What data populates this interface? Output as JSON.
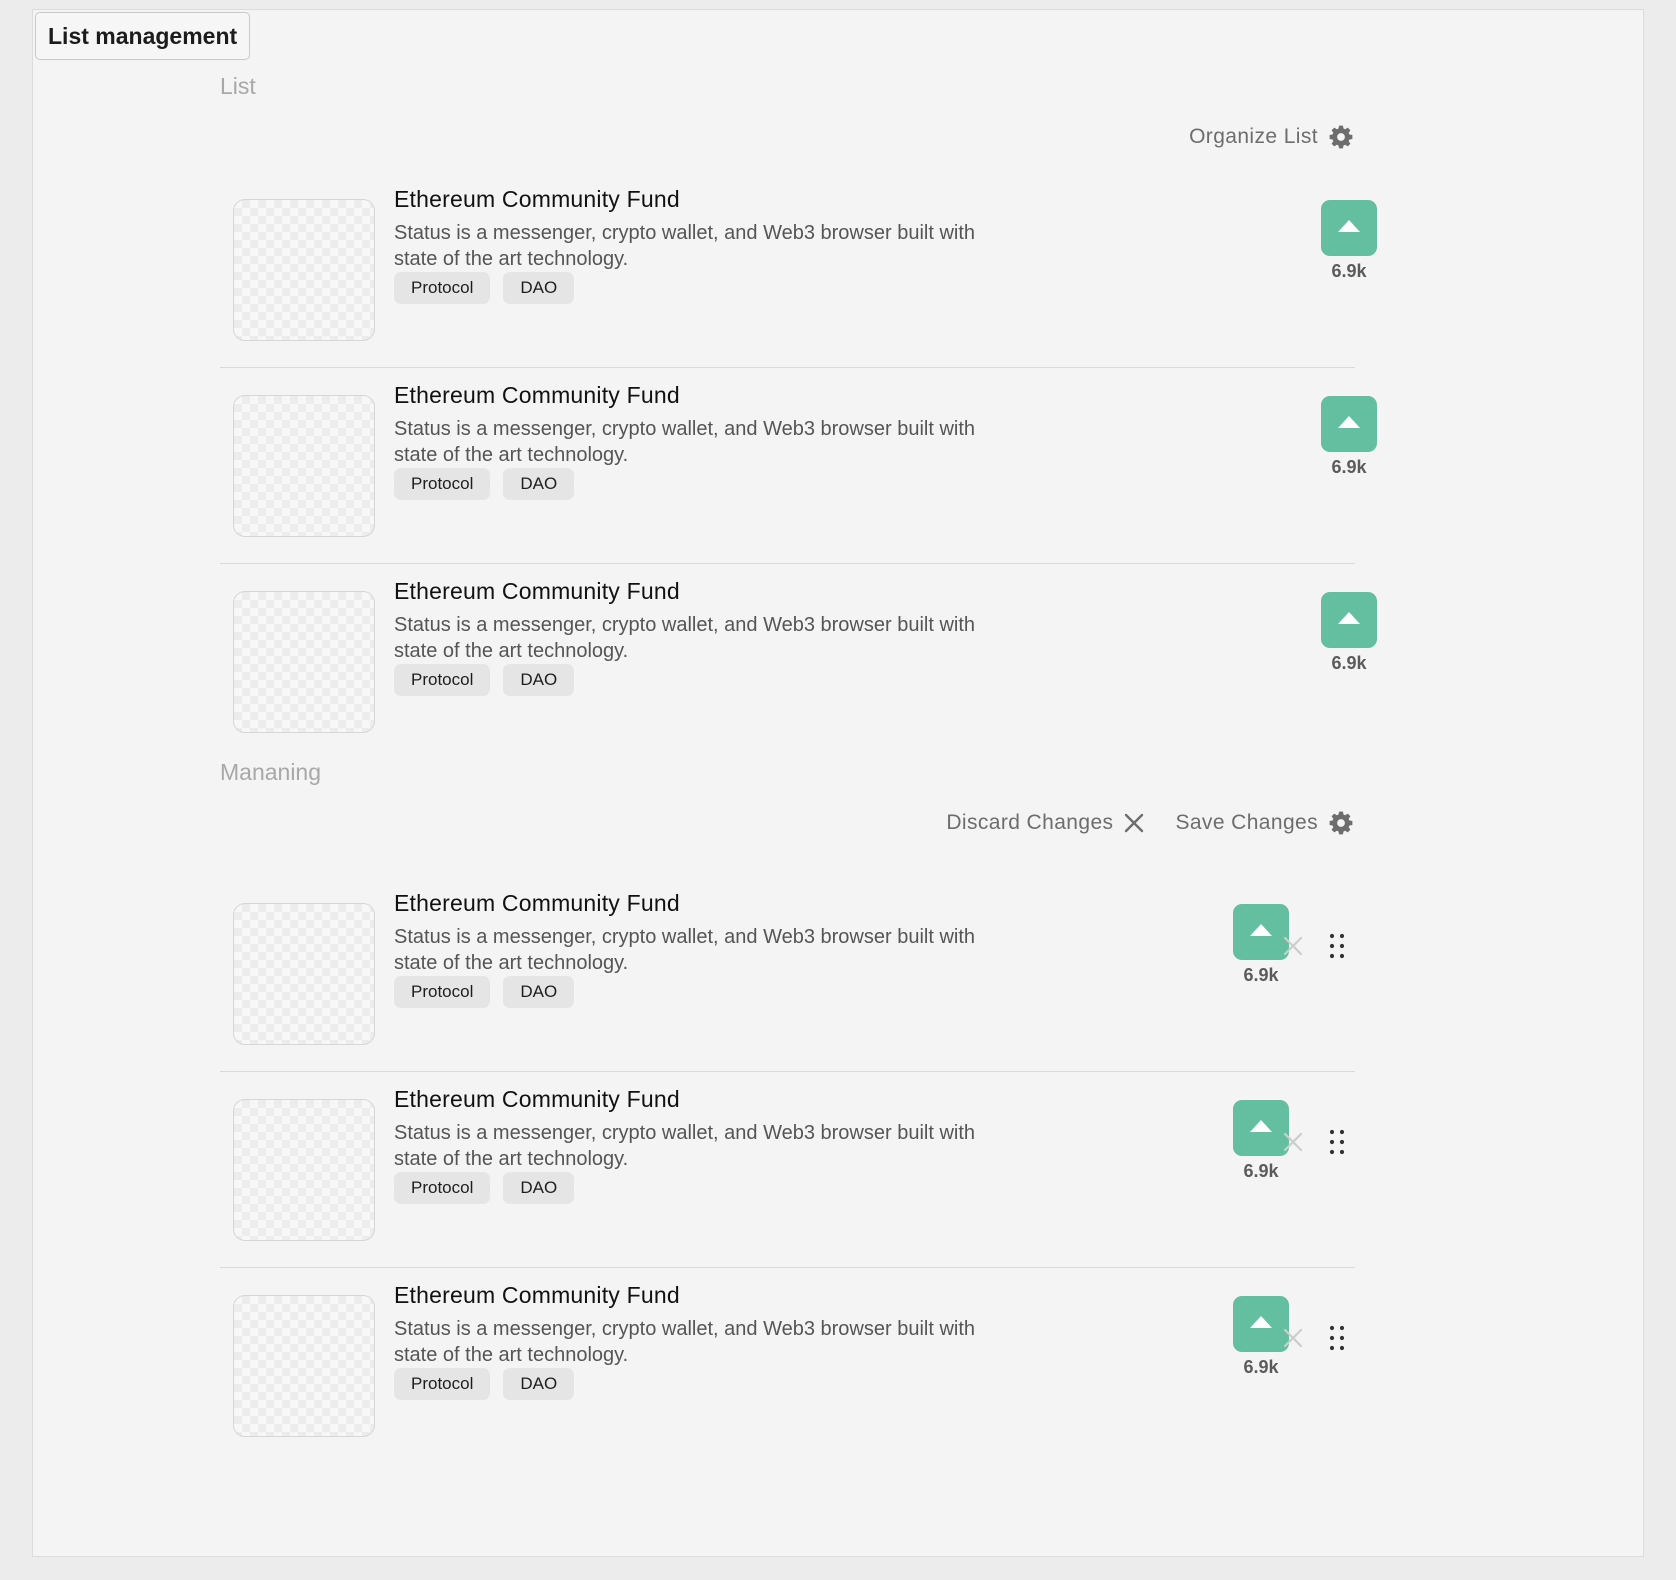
{
  "frame": {
    "title": "List management"
  },
  "colors": {
    "accent": "#63bfa0",
    "tag_bg": "#e5e5e5",
    "muted_text": "#a8a8a8"
  },
  "list_section": {
    "label": "List",
    "organize_label": "Organize List",
    "organize_icon": "gear-icon",
    "items": [
      {
        "title": "Ethereum Community Fund",
        "description": "Status is a messenger, crypto wallet, and Web3 browser built with state of the art technology.",
        "tags": [
          "Protocol",
          "DAO"
        ],
        "votes": "6.9k",
        "vote_icon": "arrow-up-icon"
      },
      {
        "title": "Ethereum Community Fund",
        "description": "Status is a messenger, crypto wallet, and Web3 browser built with state of the art technology.",
        "tags": [
          "Protocol",
          "DAO"
        ],
        "votes": "6.9k",
        "vote_icon": "arrow-up-icon"
      },
      {
        "title": "Ethereum Community Fund",
        "description": "Status is a messenger, crypto wallet, and Web3 browser built with state of the art technology.",
        "tags": [
          "Protocol",
          "DAO"
        ],
        "votes": "6.9k",
        "vote_icon": "arrow-up-icon"
      }
    ]
  },
  "managing_section": {
    "label": "Mananing",
    "discard_label": "Discard Changes",
    "discard_icon": "close-icon",
    "save_label": "Save Changes",
    "save_icon": "gear-icon",
    "items": [
      {
        "title": "Ethereum Community Fund",
        "description": "Status is a messenger, crypto wallet, and Web3 browser built with state of the art technology.",
        "tags": [
          "Protocol",
          "DAO"
        ],
        "votes": "6.9k",
        "vote_icon": "arrow-up-icon",
        "remove_icon": "close-icon",
        "drag_icon": "drag-handle-icon"
      },
      {
        "title": "Ethereum Community Fund",
        "description": "Status is a messenger, crypto wallet, and Web3 browser built with state of the art technology.",
        "tags": [
          "Protocol",
          "DAO"
        ],
        "votes": "6.9k",
        "vote_icon": "arrow-up-icon",
        "remove_icon": "close-icon",
        "drag_icon": "drag-handle-icon"
      },
      {
        "title": "Ethereum Community Fund",
        "description": "Status is a messenger, crypto wallet, and Web3 browser built with state of the art technology.",
        "tags": [
          "Protocol",
          "DAO"
        ],
        "votes": "6.9k",
        "vote_icon": "arrow-up-icon",
        "remove_icon": "close-icon",
        "drag_icon": "drag-handle-icon"
      }
    ]
  }
}
